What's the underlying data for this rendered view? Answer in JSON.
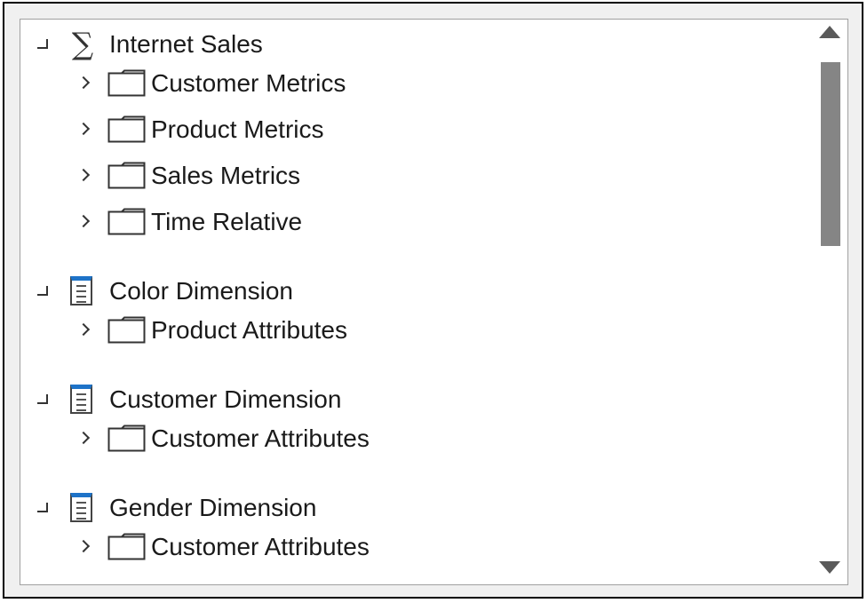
{
  "tree": {
    "groups": [
      {
        "label": "Internet Sales",
        "icon": "sum-icon",
        "children": [
          {
            "label": "Customer Metrics"
          },
          {
            "label": "Product Metrics"
          },
          {
            "label": "Sales Metrics"
          },
          {
            "label": "Time Relative"
          }
        ]
      },
      {
        "label": "Color Dimension",
        "icon": "table-icon",
        "children": [
          {
            "label": "Product Attributes"
          }
        ]
      },
      {
        "label": "Customer Dimension",
        "icon": "table-icon",
        "children": [
          {
            "label": "Customer Attributes"
          }
        ]
      },
      {
        "label": "Gender Dimension",
        "icon": "table-icon",
        "children": [
          {
            "label": "Customer Attributes"
          }
        ]
      }
    ]
  },
  "colors": {
    "table_icon_accent": "#1e73c8",
    "scrollbar_thumb": "#858585"
  },
  "scrollbar": {
    "visible_fraction": 0.33,
    "position_fraction": 0.0
  }
}
